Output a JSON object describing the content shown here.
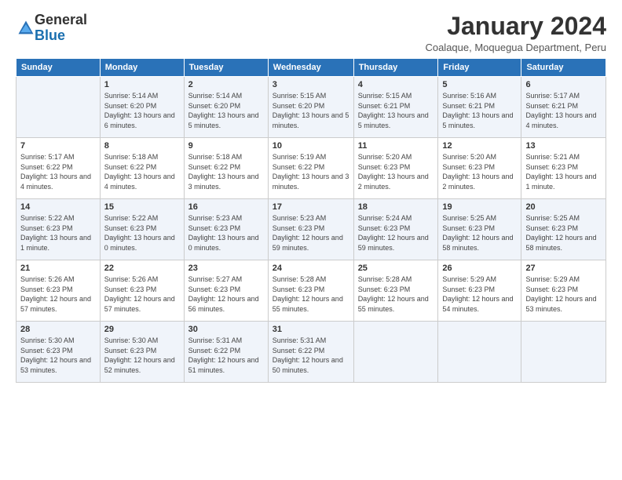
{
  "logo": {
    "general": "General",
    "blue": "Blue"
  },
  "header": {
    "title": "January 2024",
    "location": "Coalaque, Moquegua Department, Peru"
  },
  "weekdays": [
    "Sunday",
    "Monday",
    "Tuesday",
    "Wednesday",
    "Thursday",
    "Friday",
    "Saturday"
  ],
  "weeks": [
    [
      {
        "day": "",
        "sunrise": "",
        "sunset": "",
        "daylight": ""
      },
      {
        "day": "1",
        "sunrise": "Sunrise: 5:14 AM",
        "sunset": "Sunset: 6:20 PM",
        "daylight": "Daylight: 13 hours and 6 minutes."
      },
      {
        "day": "2",
        "sunrise": "Sunrise: 5:14 AM",
        "sunset": "Sunset: 6:20 PM",
        "daylight": "Daylight: 13 hours and 5 minutes."
      },
      {
        "day": "3",
        "sunrise": "Sunrise: 5:15 AM",
        "sunset": "Sunset: 6:20 PM",
        "daylight": "Daylight: 13 hours and 5 minutes."
      },
      {
        "day": "4",
        "sunrise": "Sunrise: 5:15 AM",
        "sunset": "Sunset: 6:21 PM",
        "daylight": "Daylight: 13 hours and 5 minutes."
      },
      {
        "day": "5",
        "sunrise": "Sunrise: 5:16 AM",
        "sunset": "Sunset: 6:21 PM",
        "daylight": "Daylight: 13 hours and 5 minutes."
      },
      {
        "day": "6",
        "sunrise": "Sunrise: 5:17 AM",
        "sunset": "Sunset: 6:21 PM",
        "daylight": "Daylight: 13 hours and 4 minutes."
      }
    ],
    [
      {
        "day": "7",
        "sunrise": "Sunrise: 5:17 AM",
        "sunset": "Sunset: 6:22 PM",
        "daylight": "Daylight: 13 hours and 4 minutes."
      },
      {
        "day": "8",
        "sunrise": "Sunrise: 5:18 AM",
        "sunset": "Sunset: 6:22 PM",
        "daylight": "Daylight: 13 hours and 4 minutes."
      },
      {
        "day": "9",
        "sunrise": "Sunrise: 5:18 AM",
        "sunset": "Sunset: 6:22 PM",
        "daylight": "Daylight: 13 hours and 3 minutes."
      },
      {
        "day": "10",
        "sunrise": "Sunrise: 5:19 AM",
        "sunset": "Sunset: 6:22 PM",
        "daylight": "Daylight: 13 hours and 3 minutes."
      },
      {
        "day": "11",
        "sunrise": "Sunrise: 5:20 AM",
        "sunset": "Sunset: 6:23 PM",
        "daylight": "Daylight: 13 hours and 2 minutes."
      },
      {
        "day": "12",
        "sunrise": "Sunrise: 5:20 AM",
        "sunset": "Sunset: 6:23 PM",
        "daylight": "Daylight: 13 hours and 2 minutes."
      },
      {
        "day": "13",
        "sunrise": "Sunrise: 5:21 AM",
        "sunset": "Sunset: 6:23 PM",
        "daylight": "Daylight: 13 hours and 1 minute."
      }
    ],
    [
      {
        "day": "14",
        "sunrise": "Sunrise: 5:22 AM",
        "sunset": "Sunset: 6:23 PM",
        "daylight": "Daylight: 13 hours and 1 minute."
      },
      {
        "day": "15",
        "sunrise": "Sunrise: 5:22 AM",
        "sunset": "Sunset: 6:23 PM",
        "daylight": "Daylight: 13 hours and 0 minutes."
      },
      {
        "day": "16",
        "sunrise": "Sunrise: 5:23 AM",
        "sunset": "Sunset: 6:23 PM",
        "daylight": "Daylight: 13 hours and 0 minutes."
      },
      {
        "day": "17",
        "sunrise": "Sunrise: 5:23 AM",
        "sunset": "Sunset: 6:23 PM",
        "daylight": "Daylight: 12 hours and 59 minutes."
      },
      {
        "day": "18",
        "sunrise": "Sunrise: 5:24 AM",
        "sunset": "Sunset: 6:23 PM",
        "daylight": "Daylight: 12 hours and 59 minutes."
      },
      {
        "day": "19",
        "sunrise": "Sunrise: 5:25 AM",
        "sunset": "Sunset: 6:23 PM",
        "daylight": "Daylight: 12 hours and 58 minutes."
      },
      {
        "day": "20",
        "sunrise": "Sunrise: 5:25 AM",
        "sunset": "Sunset: 6:23 PM",
        "daylight": "Daylight: 12 hours and 58 minutes."
      }
    ],
    [
      {
        "day": "21",
        "sunrise": "Sunrise: 5:26 AM",
        "sunset": "Sunset: 6:23 PM",
        "daylight": "Daylight: 12 hours and 57 minutes."
      },
      {
        "day": "22",
        "sunrise": "Sunrise: 5:26 AM",
        "sunset": "Sunset: 6:23 PM",
        "daylight": "Daylight: 12 hours and 57 minutes."
      },
      {
        "day": "23",
        "sunrise": "Sunrise: 5:27 AM",
        "sunset": "Sunset: 6:23 PM",
        "daylight": "Daylight: 12 hours and 56 minutes."
      },
      {
        "day": "24",
        "sunrise": "Sunrise: 5:28 AM",
        "sunset": "Sunset: 6:23 PM",
        "daylight": "Daylight: 12 hours and 55 minutes."
      },
      {
        "day": "25",
        "sunrise": "Sunrise: 5:28 AM",
        "sunset": "Sunset: 6:23 PM",
        "daylight": "Daylight: 12 hours and 55 minutes."
      },
      {
        "day": "26",
        "sunrise": "Sunrise: 5:29 AM",
        "sunset": "Sunset: 6:23 PM",
        "daylight": "Daylight: 12 hours and 54 minutes."
      },
      {
        "day": "27",
        "sunrise": "Sunrise: 5:29 AM",
        "sunset": "Sunset: 6:23 PM",
        "daylight": "Daylight: 12 hours and 53 minutes."
      }
    ],
    [
      {
        "day": "28",
        "sunrise": "Sunrise: 5:30 AM",
        "sunset": "Sunset: 6:23 PM",
        "daylight": "Daylight: 12 hours and 53 minutes."
      },
      {
        "day": "29",
        "sunrise": "Sunrise: 5:30 AM",
        "sunset": "Sunset: 6:23 PM",
        "daylight": "Daylight: 12 hours and 52 minutes."
      },
      {
        "day": "30",
        "sunrise": "Sunrise: 5:31 AM",
        "sunset": "Sunset: 6:22 PM",
        "daylight": "Daylight: 12 hours and 51 minutes."
      },
      {
        "day": "31",
        "sunrise": "Sunrise: 5:31 AM",
        "sunset": "Sunset: 6:22 PM",
        "daylight": "Daylight: 12 hours and 50 minutes."
      },
      {
        "day": "",
        "sunrise": "",
        "sunset": "",
        "daylight": ""
      },
      {
        "day": "",
        "sunrise": "",
        "sunset": "",
        "daylight": ""
      },
      {
        "day": "",
        "sunrise": "",
        "sunset": "",
        "daylight": ""
      }
    ]
  ]
}
